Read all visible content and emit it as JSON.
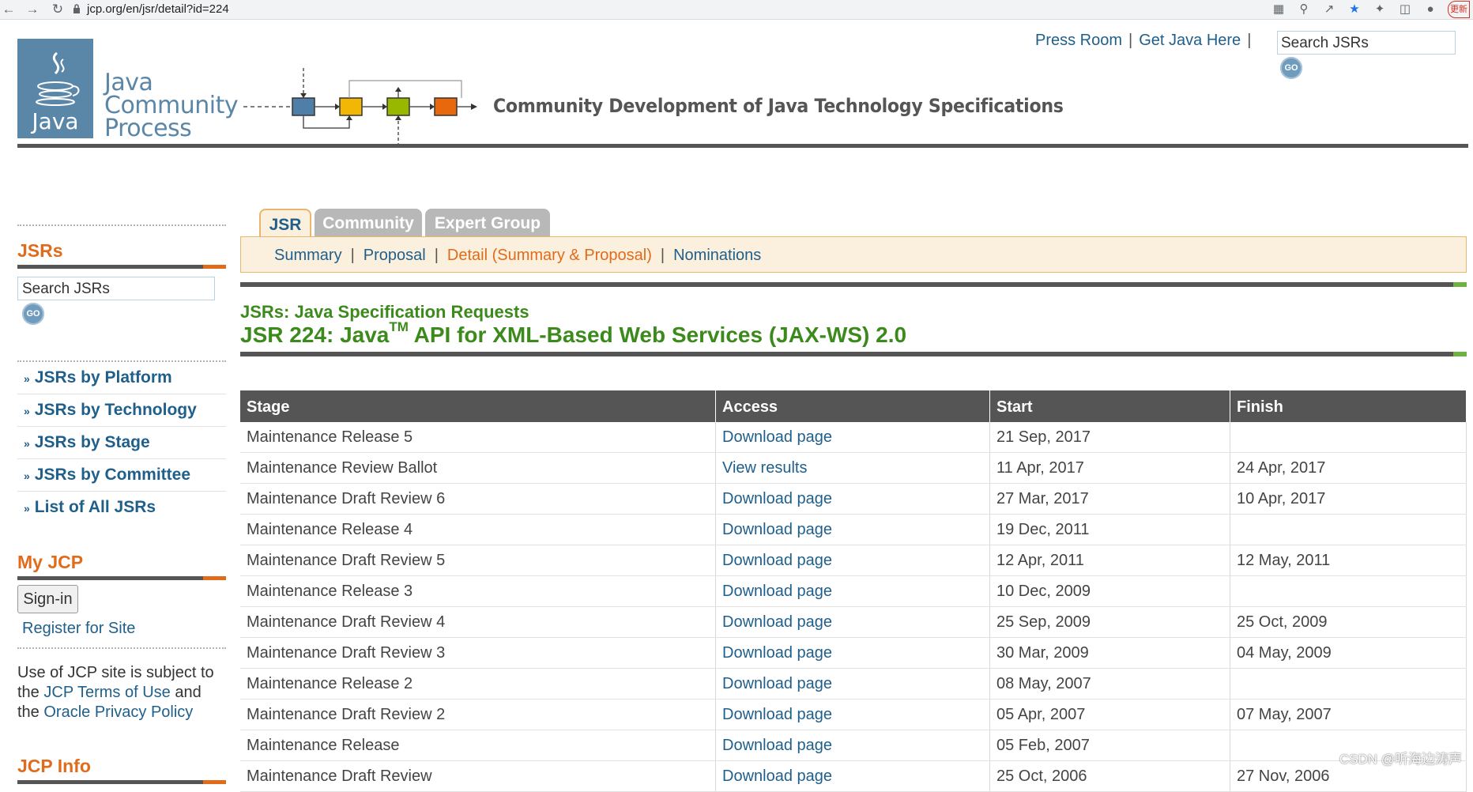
{
  "browser": {
    "url": "jcp.org/en/jsr/detail?id=224",
    "update_label": "更新"
  },
  "header": {
    "logo": {
      "badge": "Java",
      "line1": "Java",
      "line2": "Community",
      "line3": "Process"
    },
    "tagline": "Community Development of Java Technology Specifications",
    "press_room": "Press Room",
    "get_java": "Get Java Here",
    "search_placeholder": "Search JSRs",
    "go_label": "GO"
  },
  "sidebar": {
    "jsrs_title": "JSRs",
    "search_placeholder": "Search JSRs",
    "go_label": "GO",
    "nav": [
      "JSRs by Platform",
      "JSRs by Technology",
      "JSRs by Stage",
      "JSRs by Committee",
      "List of All JSRs"
    ],
    "myjcp_title": "My JCP",
    "signin_label": "Sign-in",
    "register_label": "Register for Site",
    "terms": {
      "pre": "Use of JCP site is subject to the",
      "terms_link": "JCP Terms of Use",
      "and": "and the",
      "privacy_link": "Oracle Privacy Policy"
    },
    "jcpinfo_title": "JCP Info"
  },
  "tabs": [
    {
      "label": "JSR",
      "active": true
    },
    {
      "label": "Community",
      "active": false
    },
    {
      "label": "Expert Group",
      "active": false
    }
  ],
  "subnav": {
    "summary": "Summary",
    "proposal": "Proposal",
    "detail": "Detail (Summary & Proposal)",
    "nominations": "Nominations"
  },
  "content": {
    "crumb": "JSRs: Java Specification Requests",
    "title_pre": "JSR 224: Java",
    "title_tm": "TM",
    "title_post": " API for XML-Based Web Services (JAX-WS) 2.0"
  },
  "table": {
    "headers": [
      "Stage",
      "Access",
      "Start",
      "Finish"
    ],
    "rows": [
      [
        "Maintenance Release 5",
        "Download page",
        "21 Sep, 2017",
        ""
      ],
      [
        "Maintenance Review Ballot",
        "View results",
        "11 Apr, 2017",
        "24 Apr, 2017"
      ],
      [
        "Maintenance Draft Review 6",
        "Download page",
        "27 Mar, 2017",
        "10 Apr, 2017"
      ],
      [
        "Maintenance Release 4",
        "Download page",
        "19 Dec, 2011",
        ""
      ],
      [
        "Maintenance Draft Review 5",
        "Download page",
        "12 Apr, 2011",
        "12 May, 2011"
      ],
      [
        "Maintenance Release 3",
        "Download page",
        "10 Dec, 2009",
        ""
      ],
      [
        "Maintenance Draft Review 4",
        "Download page",
        "25 Sep, 2009",
        "25 Oct, 2009"
      ],
      [
        "Maintenance Draft Review 3",
        "Download page",
        "30 Mar, 2009",
        "04 May, 2009"
      ],
      [
        "Maintenance Release 2",
        "Download page",
        "08 May, 2007",
        ""
      ],
      [
        "Maintenance Draft Review 2",
        "Download page",
        "05 Apr, 2007",
        "07 May, 2007"
      ],
      [
        "Maintenance Release",
        "Download page",
        "05 Feb, 2007",
        ""
      ],
      [
        "Maintenance Draft Review",
        "Download page",
        "25 Oct, 2006",
        "27 Nov, 2006"
      ]
    ]
  },
  "watermark": "CSDN @听海边涛声"
}
